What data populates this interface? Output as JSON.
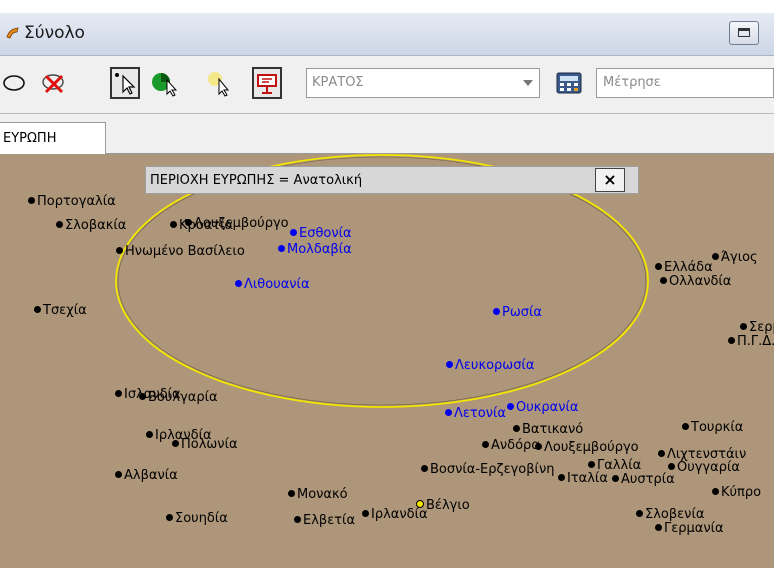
{
  "window": {
    "title": "Σύνολο"
  },
  "toolbar": {
    "tools": [
      {
        "name": "lasso-tool-icon"
      },
      {
        "name": "clear-selection-icon"
      },
      {
        "name": "select-pointer-icon",
        "pressed": true
      },
      {
        "name": "pie-select-icon"
      },
      {
        "name": "highlight-pointer-icon"
      },
      {
        "name": "presentation-icon",
        "pressed": true
      }
    ],
    "combo_value": "ΚΡΑΤΟΣ",
    "measure_value": "Μέτρησε"
  },
  "tabs": [
    {
      "label": "ΕΥΡΩΠΗ"
    }
  ],
  "info": {
    "text": "ΠΕΡΙΟΧΗ ΕΥΡΩΠΗΣ = Ανατολική",
    "close": "×"
  },
  "map": {
    "background": "#ad9679",
    "selected_color": "#0000ee",
    "ellipse_color": "#f2e600",
    "countries": [
      {
        "label": "Πορτογαλία",
        "selected": false
      },
      {
        "label": "Σλοβακία",
        "selected": false
      },
      {
        "label": "Κροατία",
        "selected": false
      },
      {
        "label": "Λουξεμβούργο",
        "selected": false
      },
      {
        "label": "Εσθονία",
        "selected": true
      },
      {
        "label": "Ηνωμένο Βασίλειο",
        "selected": false
      },
      {
        "label": "Μολδαβία",
        "selected": true
      },
      {
        "label": "Λιθουανία",
        "selected": true
      },
      {
        "label": "Τσεχία",
        "selected": false
      },
      {
        "label": "Ρωσία",
        "selected": true
      },
      {
        "label": "Λευκορωσία",
        "selected": true
      },
      {
        "label": "Λετονία",
        "selected": true
      },
      {
        "label": "Ουκρανία",
        "selected": true
      },
      {
        "label": "Ισλανδία",
        "selected": false
      },
      {
        "label": "Βουλγαρία",
        "selected": false
      },
      {
        "label": "Ιρλανδία",
        "selected": false
      },
      {
        "label": "Πολωνία",
        "selected": false
      },
      {
        "label": "Αλβανία",
        "selected": false
      },
      {
        "label": "Μονακό",
        "selected": false
      },
      {
        "label": "Σουηδία",
        "selected": false
      },
      {
        "label": "Ελβετία",
        "selected": false
      },
      {
        "label": "Ιρλανδία",
        "selected": false
      },
      {
        "label": "Βέλγιο",
        "selected": false
      },
      {
        "label": "Βατικανό",
        "selected": false
      },
      {
        "label": "Ανδόρα",
        "selected": false
      },
      {
        "label": "Λουξεμβούργο",
        "selected": false
      },
      {
        "label": "Βοσνία-Ερζεγοβίνη",
        "selected": false
      },
      {
        "label": "Γαλλία",
        "selected": false
      },
      {
        "label": "Ιταλία",
        "selected": false
      },
      {
        "label": "Αυστρία",
        "selected": false
      },
      {
        "label": "Ελλάδα",
        "selected": false
      },
      {
        "label": "Άγιος",
        "selected": false
      },
      {
        "label": "Ολλανδία",
        "selected": false
      },
      {
        "label": "Σερβ",
        "selected": false
      },
      {
        "label": "Π.Γ.Δ.",
        "selected": false
      },
      {
        "label": "Τουρκία",
        "selected": false
      },
      {
        "label": "Λιχτενστάιν",
        "selected": false
      },
      {
        "label": "Ουγγαρία",
        "selected": false
      },
      {
        "label": "Κύπρο",
        "selected": false
      },
      {
        "label": "Σλοβενία",
        "selected": false
      },
      {
        "label": "Γερμανία",
        "selected": false
      }
    ]
  }
}
